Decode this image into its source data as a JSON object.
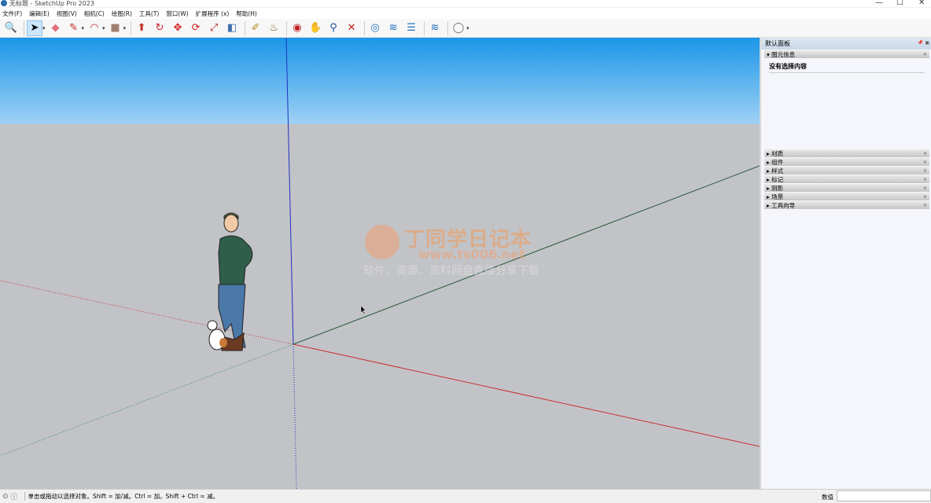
{
  "window": {
    "title": "无标题 - SketchUp Pro 2023"
  },
  "menu": [
    "文件(F)",
    "编辑(E)",
    "视图(V)",
    "相机(C)",
    "绘图(R)",
    "工具(T)",
    "窗口(W)",
    "扩展程序 (x)",
    "帮助(H)"
  ],
  "toolbar": [
    {
      "name": "zoom-extents-icon",
      "glyph": "🔍"
    },
    {
      "sep": true
    },
    {
      "name": "select-icon",
      "glyph": "➤",
      "selected": true,
      "dropdown": true
    },
    {
      "name": "eraser-icon",
      "glyph": "◆",
      "color": "#e07080"
    },
    {
      "name": "pencil-icon",
      "glyph": "✎",
      "color": "#c02020",
      "dropdown": true
    },
    {
      "name": "arc-icon",
      "glyph": "◠",
      "color": "#c03030",
      "dropdown": true
    },
    {
      "name": "rectangle-icon",
      "glyph": "■",
      "color": "#a08070",
      "dropdown": true
    },
    {
      "sep": true
    },
    {
      "name": "push-pull-icon",
      "glyph": "⬆",
      "color": "#c03020"
    },
    {
      "name": "follow-me-icon",
      "glyph": "↻",
      "color": "#d02030"
    },
    {
      "name": "move-icon",
      "glyph": "✥",
      "color": "#d02020"
    },
    {
      "name": "rotate-icon",
      "glyph": "⟳",
      "color": "#d02020"
    },
    {
      "name": "scale-icon",
      "glyph": "⤢",
      "color": "#c02020"
    },
    {
      "name": "offset-icon",
      "glyph": "◧",
      "color": "#4070b0"
    },
    {
      "sep": true
    },
    {
      "name": "tape-measure-icon",
      "glyph": "✐",
      "color": "#b09020"
    },
    {
      "name": "paint-bucket-icon",
      "glyph": "♨",
      "color": "#806020"
    },
    {
      "sep": true
    },
    {
      "name": "orbit-icon",
      "glyph": "◉",
      "color": "#c02020"
    },
    {
      "name": "pan-icon",
      "glyph": "✋",
      "color": "#d0b060"
    },
    {
      "name": "zoom-icon",
      "glyph": "⚲",
      "color": "#2050a0"
    },
    {
      "name": "zoom-window-icon",
      "glyph": "✕",
      "color": "#c02020"
    },
    {
      "sep": true
    },
    {
      "name": "warehouse-icon",
      "glyph": "◎",
      "color": "#2070c0"
    },
    {
      "name": "extension-warehouse-icon",
      "glyph": "≋",
      "color": "#2070c0"
    },
    {
      "name": "layout-icon",
      "glyph": "☰",
      "color": "#2070c0"
    },
    {
      "sep": true
    },
    {
      "name": "extension-manager-icon",
      "glyph": "≋",
      "color": "#2070c0"
    },
    {
      "sep": true
    },
    {
      "name": "account-icon",
      "glyph": "◯",
      "color": "#666",
      "dropdown": true
    }
  ],
  "watermark": {
    "title": "丁同学日记本",
    "url": "www.ts006.net",
    "tagline": "软件、资源、资料网盘直接分享下载"
  },
  "panel": {
    "title": "默认面板",
    "entity_info": {
      "label": "图元信息",
      "empty": "没有选择内容"
    },
    "sections": [
      "材质",
      "组件",
      "样式",
      "标记",
      "阴影",
      "场景",
      "工具向导"
    ]
  },
  "status": {
    "message": "单击或拖动以选择对象。Shift = 加/减。Ctrl = 加。Shift + Ctrl = 减。",
    "value_label": "数值",
    "value": ""
  },
  "colors": {
    "sky": "#1c96e8",
    "ground": "#c2c3c7",
    "red_axis": "#c83030",
    "green_axis": "#2a7a3a",
    "blue_axis": "#2030c0"
  }
}
